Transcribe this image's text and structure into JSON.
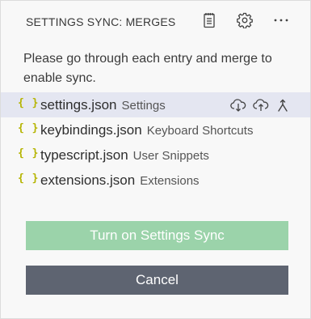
{
  "header": {
    "title": "SETTINGS SYNC: MERGES",
    "actions": [
      {
        "icon": "notebook-icon"
      },
      {
        "icon": "gear-icon"
      },
      {
        "icon": "ellipsis-icon"
      }
    ]
  },
  "message": "Please go through each entry and merge to enable sync.",
  "icons": {
    "file": "{ }",
    "row_actions": [
      "cloud-download-icon",
      "cloud-upload-icon",
      "merge-icon"
    ]
  },
  "entries": [
    {
      "name": "settings.json",
      "description": "Settings",
      "selected": true
    },
    {
      "name": "keybindings.json",
      "description": "Keyboard Shortcuts",
      "selected": false
    },
    {
      "name": "typescript.json",
      "description": "User Snippets",
      "selected": false
    },
    {
      "name": "extensions.json",
      "description": "Extensions",
      "selected": false
    }
  ],
  "buttons": {
    "primary_label": "Turn on Settings Sync",
    "secondary_label": "Cancel"
  },
  "colors": {
    "braces": "#b5b400",
    "selected_row": "#e4e6f1",
    "primary_button": "#9bd3aa",
    "secondary_button": "#5e6471"
  }
}
